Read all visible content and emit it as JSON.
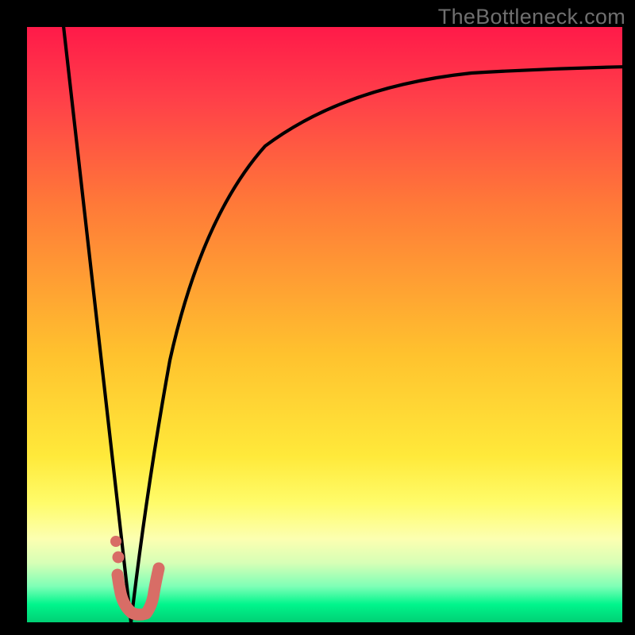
{
  "watermark": {
    "text": "TheBottleneck.com"
  },
  "colors": {
    "frame": "#000000",
    "curveStroke": "#000000",
    "markerStroke": "#d86d66",
    "markerFill": "none"
  },
  "chart_data": {
    "type": "line",
    "title": "",
    "xlabel": "",
    "ylabel": "",
    "xlim": [
      0,
      100
    ],
    "ylim": [
      0,
      100
    ],
    "grid": false,
    "legend": false,
    "series": [
      {
        "name": "left-line",
        "x": [
          6,
          17.5
        ],
        "y": [
          100,
          0
        ]
      },
      {
        "name": "right-curve",
        "x": [
          17.5,
          20,
          24,
          28,
          34,
          42,
          52,
          64,
          78,
          90,
          100
        ],
        "y": [
          0,
          20,
          44,
          58,
          70,
          78,
          84,
          88,
          91,
          92.5,
          93.3
        ]
      },
      {
        "name": "marker-j",
        "type": "scatter",
        "x": [
          15.2,
          15.6,
          16.6,
          17.6,
          18.5,
          19.7,
          20.3,
          20.6,
          20.9,
          21.4,
          22.0
        ],
        "y": [
          8.0,
          6.2,
          2.0,
          1.3,
          1.2,
          1.5,
          2.6,
          3.8,
          5.3,
          7.0,
          9.0
        ]
      }
    ],
    "annotations": []
  }
}
